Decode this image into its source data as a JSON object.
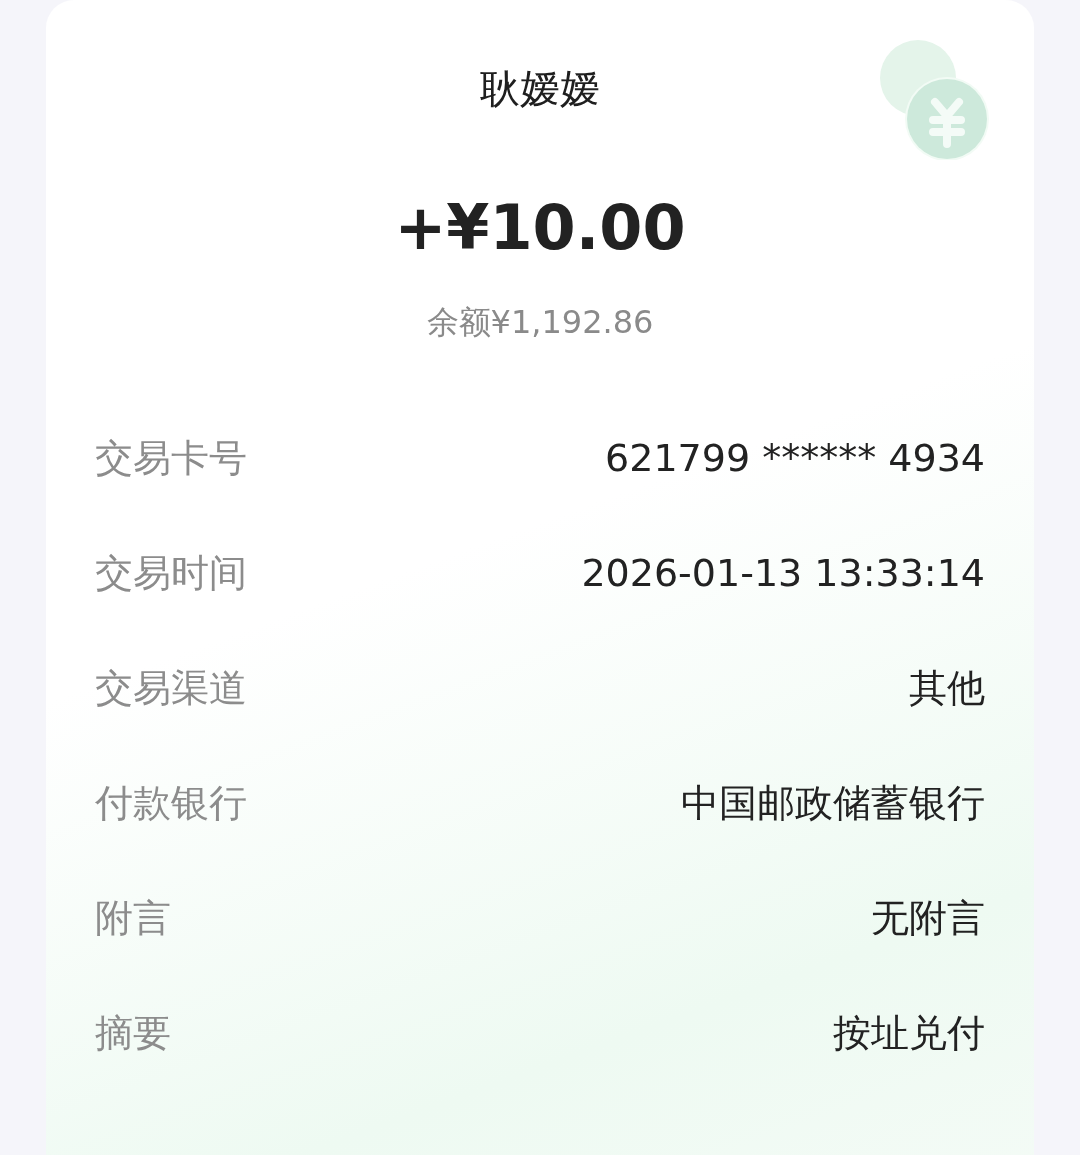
{
  "payer_name": "耿嫒嫒",
  "amount": "+¥10.00",
  "balance": "余额¥1,192.86",
  "details": [
    {
      "label": "交易卡号",
      "value": "621799 ****** 4934"
    },
    {
      "label": "交易时间",
      "value": "2026-01-13 13:33:14"
    },
    {
      "label": "交易渠道",
      "value": "其他"
    },
    {
      "label": "付款银行",
      "value": "中国邮政储蓄银行"
    },
    {
      "label": "附言",
      "value": "无附言"
    },
    {
      "label": "摘要",
      "value": "按址兑付"
    }
  ]
}
